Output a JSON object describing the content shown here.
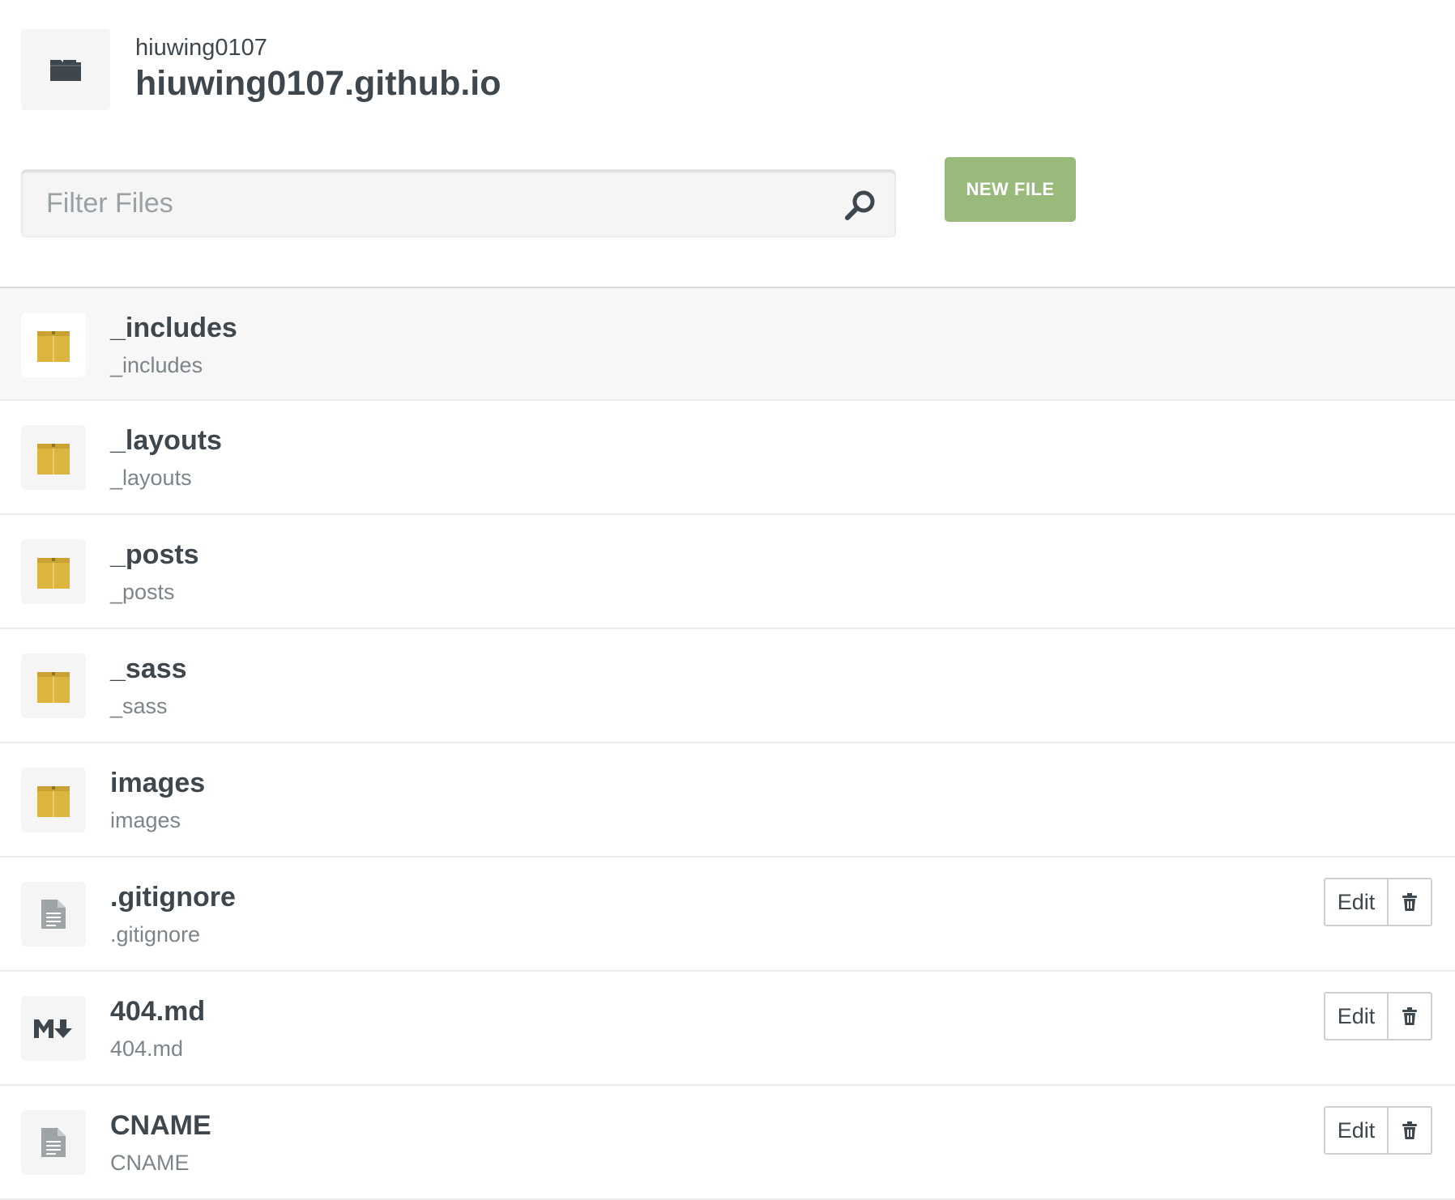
{
  "repo": {
    "owner": "hiuwing0107",
    "name": "hiuwing0107.github.io",
    "icon": "folder-icon"
  },
  "filter": {
    "placeholder": "Filter Files",
    "value": "",
    "icon": "search-icon"
  },
  "toolbar": {
    "new_file_label": "NEW FILE"
  },
  "files": [
    {
      "name": "_includes",
      "path": "_includes",
      "type": "folder",
      "icon": "folder-icon"
    },
    {
      "name": "_layouts",
      "path": "_layouts",
      "type": "folder",
      "icon": "folder-icon"
    },
    {
      "name": "_posts",
      "path": "_posts",
      "type": "folder",
      "icon": "folder-icon"
    },
    {
      "name": "_sass",
      "path": "_sass",
      "type": "folder",
      "icon": "folder-icon"
    },
    {
      "name": "images",
      "path": "images",
      "type": "folder",
      "icon": "folder-icon"
    },
    {
      "name": ".gitignore",
      "path": ".gitignore",
      "type": "file",
      "icon": "document-icon",
      "edit_label": "Edit"
    },
    {
      "name": "404.md",
      "path": "404.md",
      "type": "markdown",
      "icon": "markdown-icon",
      "edit_label": "Edit"
    },
    {
      "name": "CNAME",
      "path": "CNAME",
      "type": "file",
      "icon": "document-icon",
      "edit_label": "Edit"
    }
  ],
  "colors": {
    "folder": "#dcb53f",
    "folder_shade": "#c9a233",
    "new_file_button": "#9aba7c",
    "text": "#3d474d",
    "muted_text": "#7c858a",
    "doc_icon": "#9ea3a6"
  }
}
